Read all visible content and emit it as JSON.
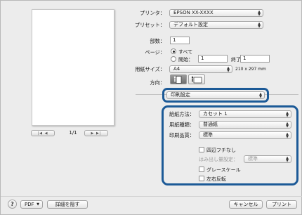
{
  "printer": {
    "label": "プリンタ：",
    "value": "EPSON XX-XXXX"
  },
  "preset": {
    "label": "プリセット：",
    "value": "デフォルト設定"
  },
  "copies": {
    "label": "部数：",
    "value": "1"
  },
  "pages": {
    "label": "ページ：",
    "all_label": "すべて",
    "from_label": "開始：",
    "from_value": "1",
    "to_label": "終了：",
    "to_value": "1"
  },
  "paper_size": {
    "label": "用紙サイズ：",
    "value": "A4",
    "dims": "210 x 297 mm"
  },
  "orientation": {
    "label": "方向："
  },
  "panel": {
    "value": "印刷設定"
  },
  "paper_source": {
    "label": "給紙方法：",
    "value": "カセット 1"
  },
  "media_type": {
    "label": "用紙種類：",
    "value": "普通紙"
  },
  "quality": {
    "label": "印刷品質：",
    "value": "標準"
  },
  "borderless": {
    "label": "四辺フチなし"
  },
  "expansion": {
    "label": "はみ出し量設定：",
    "value": "標準"
  },
  "grayscale": {
    "label": "グレースケール"
  },
  "mirror": {
    "label": "左右反転"
  },
  "preview": {
    "page_count": "1/1"
  },
  "bottom": {
    "help": "?",
    "pdf_label": "PDF",
    "hide_details": "詳細を隠す",
    "cancel": "キャンセル",
    "print": "プリント"
  },
  "colors": {
    "highlight": "#1c5a97"
  }
}
